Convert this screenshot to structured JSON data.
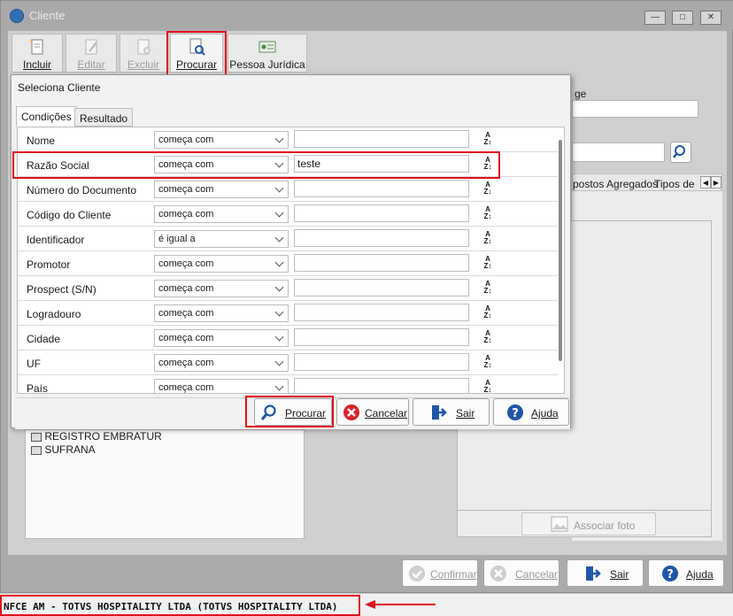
{
  "window": {
    "title": "Cliente"
  },
  "toolbar": {
    "incluir": "Incluir",
    "editar": "Editar",
    "excluir": "Excluir",
    "procurar": "Procurar",
    "pessoa_juridica": "Pessoa Jurídica"
  },
  "background": {
    "label_partial": "ge",
    "tab_impostos": "postos Agregados",
    "tab_tipos": "Tipos de",
    "list_items": [
      "REGISTRO EMBRATUR",
      "SUFRANA"
    ],
    "associar_foto": "Associar foto"
  },
  "dialog": {
    "title": "Seleciona Cliente",
    "tabs": [
      "Condições",
      "Resultado"
    ],
    "rows": [
      {
        "label": "Nome",
        "condition": "começa com",
        "value": ""
      },
      {
        "label": "Razão Social",
        "condition": "começa com",
        "value": "teste"
      },
      {
        "label": "Número do Documento",
        "condition": "começa com",
        "value": ""
      },
      {
        "label": "Código do Cliente",
        "condition": "começa com",
        "value": ""
      },
      {
        "label": "Identificador",
        "condition": "é igual a",
        "value": ""
      },
      {
        "label": "Promotor",
        "condition": "começa com",
        "value": ""
      },
      {
        "label": "Prospect (S/N)",
        "condition": "começa com",
        "value": ""
      },
      {
        "label": "Logradouro",
        "condition": "começa com",
        "value": ""
      },
      {
        "label": "Cidade",
        "condition": "começa com",
        "value": ""
      },
      {
        "label": "UF",
        "condition": "começa com",
        "value": ""
      },
      {
        "label": "País",
        "condition": "começa com",
        "value": ""
      }
    ],
    "buttons": {
      "procurar": "Procurar",
      "cancelar": "Cancelar",
      "sair": "Sair",
      "ajuda": "Ajuda"
    }
  },
  "bottom": {
    "confirmar": "Confirmar",
    "cancelar": "Cancelar",
    "sair": "Sair",
    "ajuda": "Ajuda"
  },
  "status": {
    "text": "NFCE AM - TOTVS HOSPITALITY LTDA (TOTVS HOSPITALITY LTDA)"
  },
  "colors": {
    "highlight": "#e2101a",
    "procurar_icon": "#1f56a6",
    "cancel_icon": "#d8242b",
    "help_icon": "#1f56a6"
  }
}
